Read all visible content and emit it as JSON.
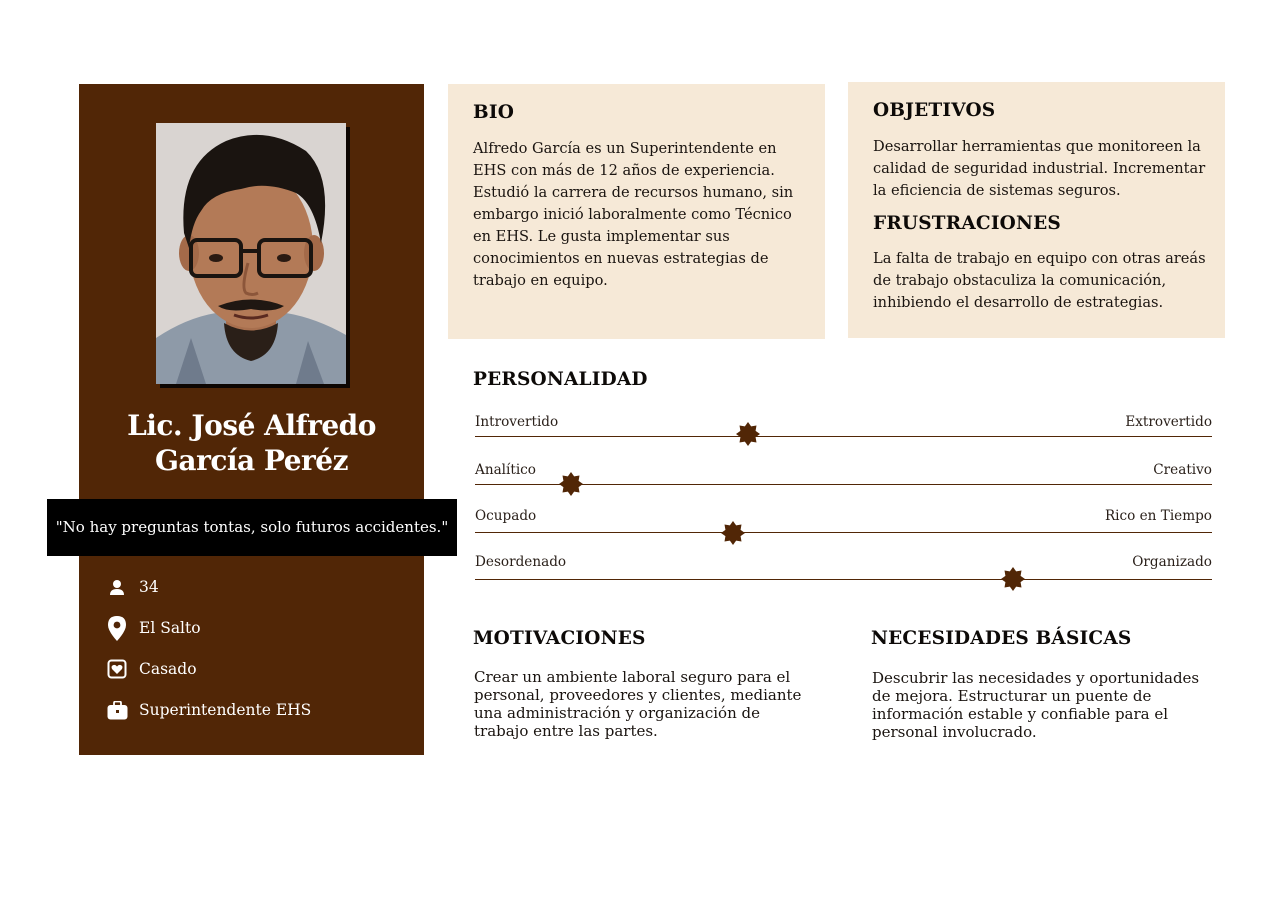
{
  "profile": {
    "name_line1": "Lic. José Alfredo",
    "name_line2": "García Peréz",
    "quote": "\"No hay preguntas tontas, solo futuros accidentes.\"",
    "facts": [
      {
        "icon": "person-icon",
        "value": "34"
      },
      {
        "icon": "location-pin-icon",
        "value": "El Salto"
      },
      {
        "icon": "heart-icon",
        "value": "Casado"
      },
      {
        "icon": "briefcase-icon",
        "value": "Superintendente EHS"
      }
    ]
  },
  "bio": {
    "title": "BIO",
    "text": "Alfredo García es un Superintendente en EHS con más de 12 años de experiencia. Estudió la carrera de recursos humano, sin embargo inició laboralmente como Técnico en EHS. Le gusta implementar sus conocimientos en nuevas estrategias de trabajo en equipo."
  },
  "goals": {
    "title": "OBJETIVOS",
    "text": "Desarrollar herramientas que monitoreen la calidad de seguridad industrial. Incrementar la eficiencia de sistemas seguros."
  },
  "frustrations": {
    "title": "FRUSTRACIONES",
    "text": "La falta de trabajo en equipo con otras areás de trabajo obstaculiza la comunicación, inhibiendo el desarrollo de estrategias."
  },
  "personality": {
    "title": "PERSONALIDAD",
    "traits": [
      {
        "left": "Introvertido",
        "right": "Extrovertido",
        "level": 0.37
      },
      {
        "left": "Analítico",
        "right": "Creativo",
        "level": 0.13
      },
      {
        "left": "Ocupado",
        "right": "Rico en Tiempo",
        "level": 0.35
      },
      {
        "left": "Desordenado",
        "right": "Organizado",
        "level": 0.73
      }
    ]
  },
  "motivations": {
    "title": "MOTIVACIONES",
    "text": "Crear un ambiente laboral seguro para el personal, proveedores y clientes, mediante una administración y organización de trabajo entre las partes."
  },
  "needs": {
    "title": "NECESIDADES BÁSICAS",
    "text": "Descubrir las necesidades y oportunidades de mejora. Estructurar un puente de información estable y confiable para el personal involucrado."
  },
  "colors": {
    "brown": "#512606",
    "panel": "#f6e9d7",
    "quote_bg": "#000000"
  }
}
